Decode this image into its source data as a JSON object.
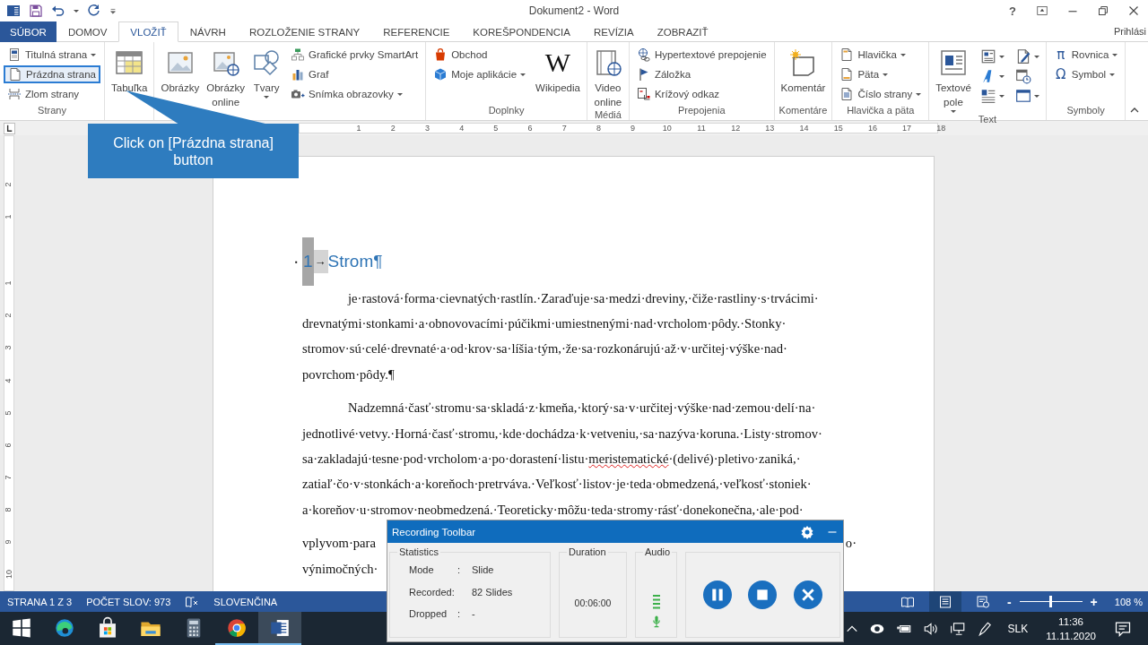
{
  "title_bar": {
    "title": "Dokument2 - Word",
    "help": "?"
  },
  "tabs": [
    {
      "label": "SÚBOR",
      "kind": "file",
      "selected": false
    },
    {
      "label": "DOMOV",
      "kind": "tab",
      "selected": false
    },
    {
      "label": "VLOŽIŤ",
      "kind": "tab",
      "selected": true
    },
    {
      "label": "NÁVRH",
      "kind": "tab",
      "selected": false
    },
    {
      "label": "ROZLOŽENIE STRANY",
      "kind": "tab",
      "selected": false
    },
    {
      "label": "REFERENCIE",
      "kind": "tab",
      "selected": false
    },
    {
      "label": "KOREŠPONDENCIA",
      "kind": "tab",
      "selected": false
    },
    {
      "label": "REVÍZIA",
      "kind": "tab",
      "selected": false
    },
    {
      "label": "ZOBRAZIŤ",
      "kind": "tab",
      "selected": false
    }
  ],
  "account": "Prihlási",
  "ribbon": {
    "groups": [
      {
        "label": "Strany",
        "columns": [
          {
            "kind": "stack",
            "items": [
              {
                "kind": "cover-page",
                "label": "Titulná strana",
                "dropdown": true,
                "hover": false
              },
              {
                "kind": "blank-page",
                "label": "Prázdna strana",
                "dropdown": false,
                "hover": true
              },
              {
                "kind": "page-break",
                "label": "Zlom strany",
                "dropdown": false,
                "hover": false
              }
            ]
          }
        ]
      },
      {
        "columns": [
          {
            "kind": "large",
            "items": [
              {
                "kind": "table",
                "lines": [
                  "Tabuľka"
                ],
                "dropdown": false,
                "hover": false
              }
            ]
          }
        ]
      },
      {
        "columns": [
          {
            "kind": "large",
            "items": [
              {
                "kind": "pictures",
                "lines": [
                  "Obrázky"
                ],
                "dropdown": false,
                "hover": false
              },
              {
                "kind": "online-pictures",
                "lines": [
                  "Obrázky",
                  "online"
                ],
                "dropdown": false,
                "hover": false
              },
              {
                "kind": "shapes",
                "lines": [
                  "Tvary"
                ],
                "dropdown": true,
                "hover": false
              }
            ]
          },
          {
            "kind": "stack",
            "items": [
              {
                "kind": "smartart",
                "label": "Grafické prvky SmartArt",
                "dropdown": false,
                "hover": false
              },
              {
                "kind": "chart",
                "label": "Graf",
                "dropdown": false,
                "hover": false
              },
              {
                "kind": "screenshot",
                "label": "Snímka obrazovky",
                "dropdown": true,
                "hover": false
              }
            ]
          }
        ]
      },
      {
        "label": "Doplnky",
        "columns": [
          {
            "kind": "stack",
            "items": [
              {
                "kind": "store",
                "label": "Obchod",
                "dropdown": false,
                "hover": false
              },
              {
                "kind": "my-apps",
                "label": "Moje aplikácie",
                "dropdown": true,
                "hover": false
              }
            ]
          },
          {
            "kind": "large",
            "items": [
              {
                "kind": "glyph",
                "glyph": "W",
                "lines": [
                  "Wikipedia"
                ],
                "dropdown": false,
                "hover": false
              }
            ]
          }
        ]
      },
      {
        "label": "Médiá",
        "columns": [
          {
            "kind": "large",
            "items": [
              {
                "kind": "video",
                "lines": [
                  "Video",
                  "online"
                ],
                "dropdown": false,
                "hover": false
              }
            ]
          }
        ]
      },
      {
        "label": "Prepojenia",
        "columns": [
          {
            "kind": "stack",
            "items": [
              {
                "kind": "hyperlink",
                "label": "Hypertextové prepojenie",
                "dropdown": false,
                "hover": false
              },
              {
                "kind": "bookmark",
                "label": "Záložka",
                "dropdown": false,
                "hover": false
              },
              {
                "kind": "cross-ref",
                "label": "Krížový odkaz",
                "dropdown": false,
                "hover": false
              }
            ]
          }
        ]
      },
      {
        "label": "Komentáre",
        "columns": [
          {
            "kind": "large",
            "items": [
              {
                "kind": "comment",
                "lines": [
                  "Komentár"
                ],
                "dropdown": false,
                "hover": false
              }
            ]
          }
        ]
      },
      {
        "label": "Hlavička a päta",
        "columns": [
          {
            "kind": "stack",
            "items": [
              {
                "kind": "header",
                "label": "Hlavička",
                "dropdown": true,
                "hover": false
              },
              {
                "kind": "footer",
                "label": "Päta",
                "dropdown": true,
                "hover": false
              },
              {
                "kind": "page-number",
                "label": "Číslo strany",
                "dropdown": true,
                "hover": false
              }
            ]
          }
        ]
      },
      {
        "label": "Text",
        "columns": [
          {
            "kind": "large",
            "items": [
              {
                "kind": "text-box",
                "lines": [
                  "Textové",
                  "pole"
                ],
                "dropdown": true,
                "hover": false
              }
            ]
          },
          {
            "kind": "grid",
            "items": [
              {
                "kind": "quick-parts",
                "dropdown": true,
                "hover": false
              },
              {
                "kind": "signature",
                "dropdown": true,
                "hover": false
              },
              {
                "kind": "wordart",
                "dropdown": true,
                "hover": false
              },
              {
                "kind": "datetime",
                "dropdown": false,
                "hover": false
              },
              {
                "kind": "dropcap",
                "dropdown": true,
                "hover": false
              },
              {
                "kind": "object",
                "dropdown": true,
                "hover": false
              }
            ]
          }
        ]
      },
      {
        "label": "Symboly",
        "columns": [
          {
            "kind": "stack",
            "items": [
              {
                "kind": "glyph",
                "glyph": "π",
                "label": "Rovnica",
                "dropdown": true,
                "hover": false
              },
              {
                "kind": "glyph",
                "glyph": "Ω",
                "label": "Symbol",
                "dropdown": true,
                "hover": false
              }
            ]
          }
        ]
      }
    ]
  },
  "callout": {
    "text": "Click on [Prázdna strana] button"
  },
  "ruler": {
    "numbers": [
      "1",
      "2",
      "3",
      "4",
      "5",
      "6",
      "7",
      "8",
      "9",
      "10",
      "11",
      "12",
      "13",
      "14",
      "15",
      "16",
      "17",
      "18"
    ]
  },
  "vertical_ruler": {
    "numbers": [
      "2",
      "1",
      "1",
      "2",
      "3",
      "4",
      "5",
      "6",
      "7",
      "8",
      "9",
      "10"
    ]
  },
  "document": {
    "heading": {
      "side_mark": "▪",
      "number": "1",
      "tab": "→",
      "text": "Strom",
      "mark": "¶"
    },
    "paragraphs": [
      {
        "lines": [
          {
            "segments": [
              {
                "text": "je·rastová·forma·cievnatých·rastlín.·Zaraďuje·sa·medzi·dreviny,·čiže·rastliny·s·trvácimi·",
                "misspelled": false
              }
            ]
          },
          {
            "segments": [
              {
                "text": "drevnatými·stonkami·a·obnovovacími·púčikmi·umiestnenými·nad·vrcholom·pôdy.·Stonky·",
                "misspelled": false
              }
            ]
          },
          {
            "segments": [
              {
                "text": "stromov·sú·celé·drevnaté·a·od·krov·sa·líšia·tým,·že·sa·rozkonárujú·až·v·určitej·výške·nad·",
                "misspelled": false
              }
            ]
          },
          {
            "segments": [
              {
                "text": "povrchom·pôdy.¶",
                "misspelled": false
              }
            ]
          }
        ]
      },
      {
        "lines": [
          {
            "segments": [
              {
                "text": "Nadzemná·časť·stromu·sa·skladá·z·kmeňa,·ktorý·sa·v·určitej·výške·nad·zemou·delí·na·",
                "misspelled": false
              }
            ]
          },
          {
            "segments": [
              {
                "text": "jednotlivé·vetvy.·Horná·časť·stromu,·kde·dochádza·k·vetveniu,·sa·nazýva·koruna.·Listy·stromov·",
                "misspelled": false
              }
            ]
          },
          {
            "segments": [
              {
                "text": "sa·zakladajú·tesne·pod·vrcholom·a·po·dorastení·listu·",
                "misspelled": false
              },
              {
                "text": "meristematické",
                "misspelled": true
              },
              {
                "text": "·(delivé)·pletivo·zaniká,·",
                "misspelled": false
              }
            ]
          },
          {
            "segments": [
              {
                "text": "zatiaľ·čo·v·stonkách·a·koreňoch·pretrváva.·Veľkosť·listov·je·teda·obmedzená,·veľkosť·stoniek·",
                "misspelled": false
              }
            ]
          },
          {
            "segments": [
              {
                "text": "a·koreňov·u·stromov·neobmedzená.·Teoreticky·môžu·teda·stromy·rásť·donekonečna,·ale·pod·",
                "misspelled": false
              }
            ]
          }
        ]
      }
    ],
    "covered_lines": [
      {
        "left": "vplyvom·para",
        "right": "o·"
      },
      {
        "left": "výnimočných·"
      }
    ]
  },
  "status_bar": {
    "page": "STRANA 1 Z 3",
    "words": "POČET SLOV: 973",
    "language": "SLOVENČINA",
    "views": [
      {
        "kind": "read",
        "selected": false
      },
      {
        "kind": "print",
        "selected": true
      },
      {
        "kind": "web",
        "selected": false
      }
    ],
    "zoom": {
      "minus": "-",
      "plus": "+",
      "level": 0.5,
      "reading": "108 %"
    }
  },
  "recording_toolbar": {
    "title": "Recording Toolbar",
    "statistics": {
      "legend": "Statistics",
      "rows": [
        {
          "label": "Mode",
          "sep": ":",
          "value": "Slide"
        },
        {
          "label": "Recorded:",
          "sep": "",
          "value": "82 Slides"
        },
        {
          "label": "Dropped",
          "sep": ":",
          "value": "-"
        }
      ]
    },
    "duration": {
      "legend": "Duration",
      "value": "00:06:00"
    },
    "audio": {
      "legend": "Audio"
    },
    "buttons": [
      {
        "kind": "pause"
      },
      {
        "kind": "stop"
      },
      {
        "kind": "close"
      }
    ]
  },
  "taskbar": {
    "apps": [
      {
        "kind": "start",
        "running": false,
        "selected": false
      },
      {
        "kind": "edge",
        "running": false,
        "selected": false
      },
      {
        "kind": "store",
        "running": false,
        "selected": false
      },
      {
        "kind": "folder",
        "running": false,
        "selected": false
      },
      {
        "kind": "calculator",
        "running": false,
        "selected": false
      },
      {
        "kind": "chrome",
        "running": true,
        "selected": false
      },
      {
        "kind": "word",
        "running": true,
        "selected": true
      }
    ],
    "language": "SLK",
    "time": "11:36",
    "date": "11.11.2020"
  }
}
